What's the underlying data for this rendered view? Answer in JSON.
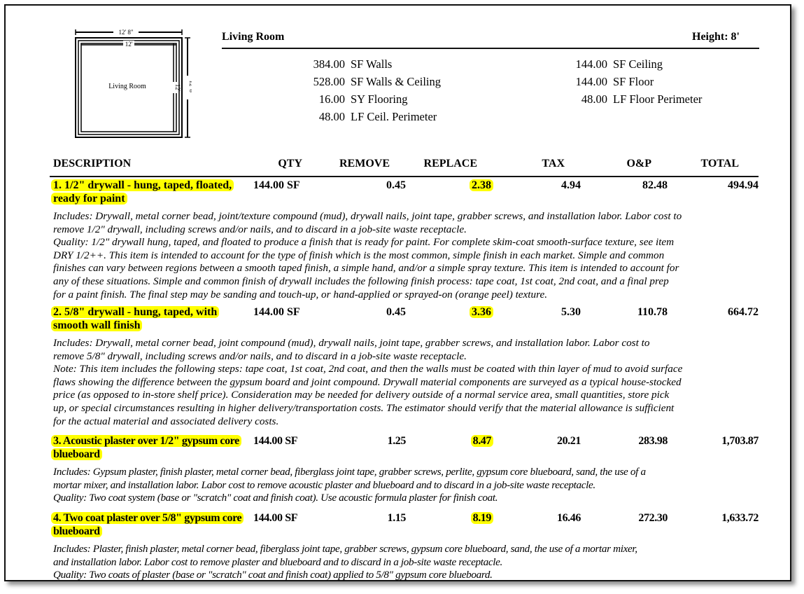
{
  "sketch": {
    "room_label": "Living Room",
    "outer_width": "12' 8\"",
    "inner_width": "12'",
    "inner_height": "12'",
    "outer_height": "12' 8\""
  },
  "room": {
    "title": "Living Room",
    "height_label": "Height: 8'",
    "measures_left": [
      {
        "value": "384.00",
        "label": "SF Walls"
      },
      {
        "value": "528.00",
        "label": "SF Walls & Ceiling"
      },
      {
        "value": "16.00",
        "label": "SY Flooring"
      },
      {
        "value": "48.00",
        "label": "LF Ceil. Perimeter"
      }
    ],
    "measures_right": [
      {
        "value": "144.00",
        "label": "SF Ceiling"
      },
      {
        "value": "144.00",
        "label": "SF Floor"
      },
      {
        "value": "48.00",
        "label": "LF Floor Perimeter"
      }
    ]
  },
  "table": {
    "headers": {
      "description": "DESCRIPTION",
      "qty": "QTY",
      "remove": "REMOVE",
      "replace": "REPLACE",
      "tax": "TAX",
      "op": "O&P",
      "total": "TOTAL"
    },
    "highlight_color": "#ffff00",
    "items": [
      {
        "description": "1.  1/2\" drywall - hung, taped, floated, ready for paint",
        "qty": "144.00 SF",
        "remove": "0.45",
        "replace": "2.38",
        "tax": "4.94",
        "op": "82.48",
        "total": "494.94",
        "note": "Includes: Drywall, metal corner bead, joint/texture compound (mud), drywall nails, joint tape, grabber screws, and installation labor.  Labor cost to\nremove 1/2\" drywall, including screws and/or nails, and to discard in a job-site waste receptacle.\n Quality: 1/2\" drywall hung, taped, and floated to produce a finish that is ready for paint. For complete skim-coat smooth-surface texture, see item\nDRY 1/2++.  This item is intended to account for the type of finish which is the most common, simple finish in each market. Simple and common\nfinishes can vary between regions between a smooth taped finish, a simple hand, and/or a simple spray texture.  This item is intended to account for\nany of these situations.  Simple and common finish of drywall includes the following finish process: tape coat, 1st coat, 2nd coat, and a final prep\nfor a paint finish.  The final step may be sanding and touch-up, or hand-applied or sprayed-on (orange peel) texture."
      },
      {
        "description": "2.  5/8\" drywall - hung, taped, with smooth wall finish",
        "qty": "144.00 SF",
        "remove": "0.45",
        "replace": "3.36",
        "tax": "5.30",
        "op": "110.78",
        "total": "664.72",
        "note": "Includes: Drywall, metal corner bead, joint compound (mud), drywall nails, joint tape, grabber screws, and installation labor.  Labor cost to\nremove 5/8\" drywall, including screws and/or nails, and to discard in a job-site waste receptacle.\n Note: This item includes the following steps: tape coat, 1st coat, 2nd coat, and then the walls must be coated with thin layer of mud to avoid surface\nflaws showing the difference between the gypsum board and joint compound.  Drywall material components are surveyed as a typical house-stocked\nprice (as opposed to in-store shelf price).  Consideration may be needed for delivery outside of a normal service area, small quantities, store pick\nup, or special circumstances resulting in higher delivery/transportation costs.  The estimator should verify that the material allowance is sufficient\nfor the actual material and associated delivery costs."
      },
      {
        "description": "3.  Acoustic plaster over 1/2\" gypsum core blueboard",
        "qty": "144.00 SF",
        "remove": "1.25",
        "replace": "8.47",
        "tax": "20.21",
        "op": "283.98",
        "total": "1,703.87",
        "note": "Includes: Gypsum plaster, finish plaster, metal corner bead, fiberglass joint tape, grabber screws, perlite, gypsum core blueboard, sand, the use of a\nmortar mixer, and installation labor.  Labor cost to remove acoustic plaster and blueboard and to discard in a job-site waste receptacle.\n Quality: Two coat system (base or \"scratch\" coat and finish coat).  Use acoustic formula plaster for finish coat."
      },
      {
        "description": "4.  Two coat plaster over 5/8\" gypsum core blueboard",
        "qty": "144.00 SF",
        "remove": "1.15",
        "replace": "8.19",
        "tax": "16.46",
        "op": "272.30",
        "total": "1,633.72",
        "note": "Includes: Plaster, finish plaster, metal corner bead, fiberglass joint tape, grabber screws, gypsum core blueboard, sand, the use of a mortar mixer,\nand installation labor.  Labor cost to remove plaster and blueboard and to discard in a job-site waste receptacle.\n Quality: Two coats of plaster (base or \"scratch\" coat and finish coat) applied to 5/8\" gypsum core blueboard."
      }
    ]
  }
}
